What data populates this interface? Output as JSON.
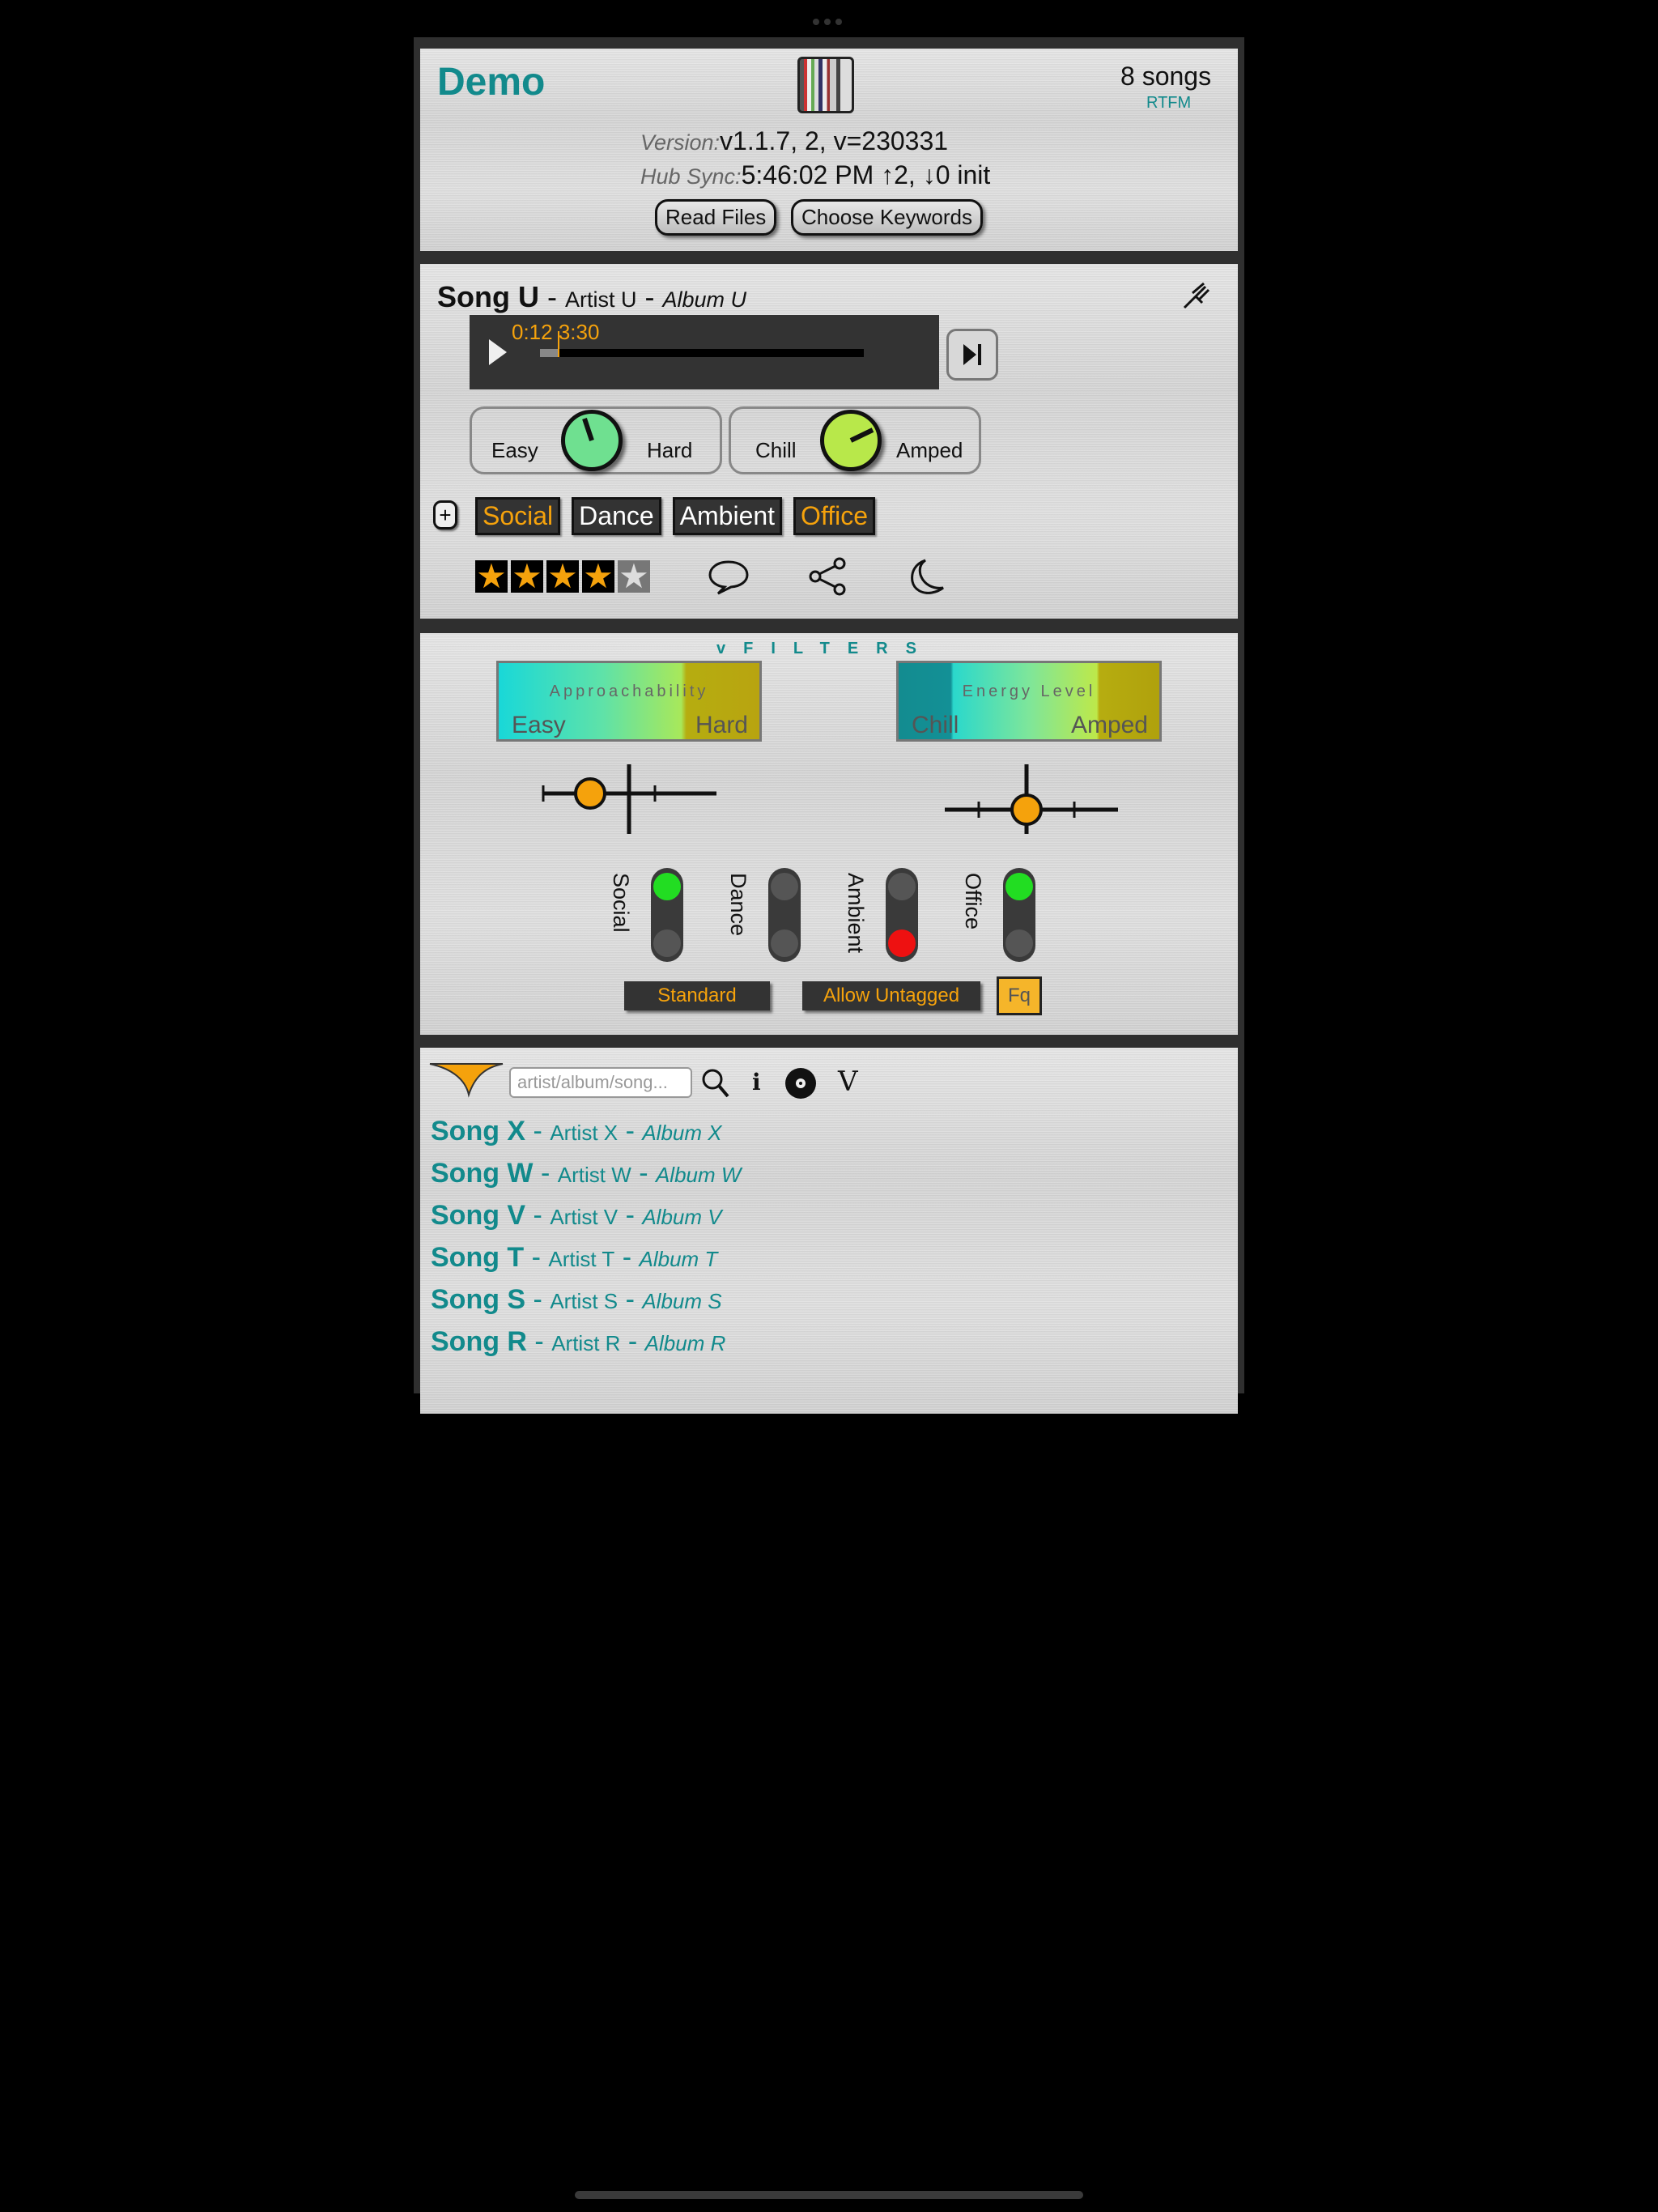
{
  "header": {
    "title": "Demo",
    "songs_count": "8 songs",
    "rtfm_link": "RTFM",
    "version_label": "Version:",
    "version_value": "v1.1.7, 2, v=230331",
    "hub_sync_label": "Hub Sync:",
    "hub_sync_value": "5:46:02 PM ↑2, ↓0 init",
    "read_files_button": "Read Files",
    "choose_keywords_button": "Choose Keywords"
  },
  "now_playing": {
    "song": "Song U",
    "artist": "Artist U",
    "album": "Album U",
    "separator": " - ",
    "elapsed": "0:12",
    "duration": "3:30",
    "progress": 0.057,
    "knob1": {
      "left": "Easy",
      "right": "Hard",
      "color": "#6fe090"
    },
    "knob2": {
      "left": "Chill",
      "right": "Amped",
      "color": "#b8e84a"
    },
    "tags": [
      {
        "label": "Social",
        "active": true
      },
      {
        "label": "Dance",
        "active": false
      },
      {
        "label": "Ambient",
        "active": false
      },
      {
        "label": "Office",
        "active": true
      }
    ],
    "rating": 4,
    "rating_max": 5
  },
  "filters": {
    "title": "vFILTERS",
    "approachability": {
      "title": "Approachability",
      "low": "Easy",
      "high": "Hard"
    },
    "energy": {
      "title": "Energy Level",
      "low": "Chill",
      "high": "Amped"
    },
    "toggles": [
      {
        "label": "Social",
        "state": "green"
      },
      {
        "label": "Dance",
        "state": "off"
      },
      {
        "label": "Ambient",
        "state": "red"
      },
      {
        "label": "Office",
        "state": "green"
      }
    ],
    "standard_button": "Standard",
    "allow_untagged_button": "Allow Untagged",
    "fq_button": "Fq"
  },
  "song_list": {
    "search_placeholder": "artist/album/song...",
    "info_icon_text": "i",
    "v_icon_text": "V",
    "rows": [
      {
        "song": "Song X",
        "artist": "Artist X",
        "album": "Album X"
      },
      {
        "song": "Song W",
        "artist": "Artist W",
        "album": "Album W"
      },
      {
        "song": "Song V",
        "artist": "Artist V",
        "album": "Album V"
      },
      {
        "song": "Song T",
        "artist": "Artist T",
        "album": "Album T"
      },
      {
        "song": "Song S",
        "artist": "Artist S",
        "album": "Album S"
      },
      {
        "song": "Song R",
        "artist": "Artist R",
        "album": "Album R"
      }
    ]
  },
  "colors": {
    "accent": "#128a8c",
    "highlight": "#f5a20c",
    "toggle_green": "#22dd22",
    "toggle_red": "#ee1111"
  }
}
